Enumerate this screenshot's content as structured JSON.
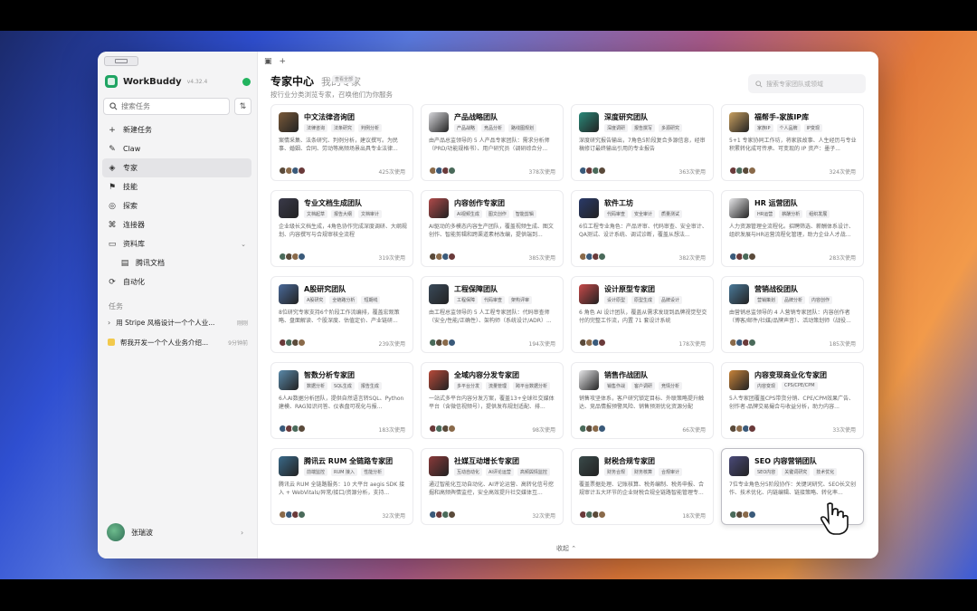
{
  "app": {
    "name": "WorkBuddy",
    "version": "v4.32.4"
  },
  "sidebar": {
    "search_placeholder": "搜索任务",
    "nav": [
      {
        "label": "新建任务",
        "icon": "plus-icon"
      },
      {
        "label": "Claw",
        "icon": "claw-icon"
      },
      {
        "label": "专家",
        "icon": "expert-icon",
        "active": true
      },
      {
        "label": "技能",
        "icon": "skill-icon"
      },
      {
        "label": "探索",
        "icon": "explore-icon"
      },
      {
        "label": "连接器",
        "icon": "connector-icon"
      },
      {
        "label": "资料库",
        "icon": "library-icon",
        "expandable": true
      },
      {
        "label": "腾讯文档",
        "icon": "doc-icon",
        "sub": true
      },
      {
        "label": "自动化",
        "icon": "automation-icon"
      }
    ],
    "tasks_label": "任务",
    "tasks": [
      {
        "title": "用 Stripe 风格设计一个个人业...",
        "time": "刚刚"
      },
      {
        "title": "帮我开发一个个人业务介绍...",
        "time": "9分钟前"
      }
    ],
    "user": {
      "name": "张瑞波"
    }
  },
  "header": {
    "title": "专家中心",
    "tab2": "我的专家",
    "tab2_badge": "查看全部",
    "subtitle": "按行业分类浏览专家，召唤他们为你服务",
    "search_placeholder": "搜索专家团队或领域"
  },
  "cards": [
    {
      "name": "中文法律咨询团",
      "tags": [
        "法律咨询",
        "法条研究",
        "判例分析"
      ],
      "desc": "案情采集、法条研究、判例分析，建议撰写。为民事、婚姻、合同、劳动等高频场景出具专业法律...",
      "uses": "425次使用",
      "color": "#7a5a3a"
    },
    {
      "name": "产品战略团队",
      "tags": [
        "产品战略",
        "竞品分析",
        "路线图规划"
      ],
      "desc": "由产品总监领导的 5 人产品专家团队：需求分析师（PRD/功能规格书）、用户研究员（调研综合分...",
      "uses": "378次使用",
      "color": "#d8d8dc"
    },
    {
      "name": "深度研究团队",
      "tags": [
        "深度调研",
        "报告撰写",
        "多源研究"
      ],
      "desc": "深度研究报告输出，7角色5阶段复合多源信息，经审稿修订最终输出引用的专业报告",
      "uses": "363次使用",
      "color": "#2a8a7a"
    },
    {
      "name": "福帮手-家族IP库",
      "tags": [
        "家族IP",
        "个人品牌",
        "IP变现"
      ],
      "desc": "5+1 专家协同工作坊，将家族故事、人生经历与专业积累转化成可传承、可变现的 IP 资产：墨子...",
      "uses": "324次使用",
      "color": "#c9a060"
    },
    {
      "name": "专业文档生成团队",
      "tags": [
        "文档起草",
        "报告大纲",
        "文档审计"
      ],
      "desc": "企业级长文档生成，4角色协作完成深度调研、大纲规划、内容撰写与合规审核全流程",
      "uses": "319次使用",
      "color": "#3a3a4a"
    },
    {
      "name": "内容创作专家团",
      "tags": [
        "AI视频生成",
        "图文创作",
        "智能剪辑"
      ],
      "desc": "AI驱动的多模态内容生产团队，覆盖视频生成、图文创作、智能剪辑和跨渠道素材改编，提供端到...",
      "uses": "385次使用",
      "color": "#b04a4a"
    },
    {
      "name": "软件工坊",
      "tags": [
        "代码审查",
        "安全审计",
        "质量测试"
      ],
      "desc": "6位工程专业角色：产品评审、代码审查、安全审计、QA测试、设计系统、调试诊断，覆盖从想法...",
      "uses": "382次使用",
      "color": "#2a3a6a"
    },
    {
      "name": "HR 运营团队",
      "tags": [
        "HR运营",
        "薪酬分析",
        "组织发展"
      ],
      "desc": "人力资源管理全流程化。招聘筛选、薪酬体系设计、组织发展与HR运营流程化管理，助力企业人才战...",
      "uses": "283次使用",
      "color": "#e8e8ea"
    },
    {
      "name": "A股研究团队",
      "tags": [
        "A股研究",
        "全链路分析",
        "短期线"
      ],
      "desc": "8位研究专家支持6个阶段工作流编排，覆盖宏观策略、盘面解读、个股深度、估值定价、产业链研...",
      "uses": "239次使用",
      "color": "#4a6a9a"
    },
    {
      "name": "工程保障团队",
      "tags": [
        "工程保障",
        "代码审查",
        "架构评审"
      ],
      "desc": "由工程总监领导的 5 人工程专家团队：代码审查师（安全/性能/正确性）、架构师（系统设计/ADR）...",
      "uses": "194次使用",
      "color": "#3a4a5a"
    },
    {
      "name": "设计原型专家团",
      "tags": [
        "设计原型",
        "原型生成",
        "品牌设计"
      ],
      "desc": "6 角色 AI 设计团队，覆盖从需求发现到品牌视觉型交付的完整工作流，内置 71 套设计系统",
      "uses": "178次使用",
      "color": "#c84a4a"
    },
    {
      "name": "营销战役团队",
      "tags": [
        "营销策划",
        "品牌分析",
        "内容创作"
      ],
      "desc": "由营销总监领导的 4 人营销专家团队：内容创作者（博客/邮件/社媒/品牌声音）、活动策划师（战役...",
      "uses": "185次使用",
      "color": "#4a7a9a"
    },
    {
      "name": "智数分析专家团",
      "tags": [
        "数据分析",
        "SQL生成",
        "报告生成"
      ],
      "desc": "6人AI数据分析团队，提供自然语言转SQL、Python建模、RAG知识问答、仪表盘可视化与报...",
      "uses": "183次使用",
      "color": "#5a8aaa"
    },
    {
      "name": "全域内容分发专家团",
      "tags": [
        "多平台分发",
        "流量管理",
        "跨平台数据分析"
      ],
      "desc": "一站式多平台内容分发方案，覆盖13+全球社交媒体平台（含微信视频号），提供发布规划适配、排...",
      "uses": "98次使用",
      "color": "#b84a3a"
    },
    {
      "name": "销售作战团队",
      "tags": [
        "销售作战",
        "客户调研",
        "竞情分析"
      ],
      "desc": "销售攻坚体系，客户研究锁定目标、外联策略提升触达、竞品情报预警风险、销售预测优化资源分配",
      "uses": "66次使用",
      "color": "#e8e8ea"
    },
    {
      "name": "内容变现商业化专家团",
      "tags": [
        "内容变现",
        "CPS/CPE/CPM"
      ],
      "desc": "5人专家团覆盖CPS带货分销、CPE/CPM效果广告、创作者-品牌交易撮合与收益分析，助力内容...",
      "uses": "33次使用",
      "color": "#c8843a"
    },
    {
      "name": "腾讯云 RUM 全链路专家团",
      "tags": [
        "前端监控",
        "RUM 接入",
        "性能分析"
      ],
      "desc": "腾讯云 RUM 全链路服务：10 大平台 aegis SDK 接入 + WebVitals/异常/接口/资源分析，支持...",
      "uses": "32次使用",
      "color": "#3a6a8a"
    },
    {
      "name": "社媒互动增长专家团",
      "tags": [
        "互动自动化",
        "AI评论运营",
        "高频舆情监控"
      ],
      "desc": "通过智能化互动自动化、AI评论运营、高转化信号挖掘和高频舆情监控，安全高效提升社交媒体互...",
      "uses": "32次使用",
      "color": "#8a3a3a"
    },
    {
      "name": "财税合规专家团",
      "tags": [
        "财务合规",
        "财务核算",
        "合规审计"
      ],
      "desc": "覆盖票据处理、记账核算、税务编制、税务申报、合规审计五大环节的企业财税合规全链路智能管理专...",
      "uses": "18次使用",
      "color": "#3a4a4a"
    },
    {
      "name": "SEO 内容营销团队",
      "tags": [
        "SEO内容",
        "关键词研究",
        "技术优化"
      ],
      "desc": "7位专业角色分5阶段协作：关键词研究、SEO长文创作、技术优化、内链编辑、链接策略、转化率...",
      "uses": "",
      "color": "#4a4a7a",
      "highlight": true
    }
  ],
  "footer": {
    "collapse_label": "收起"
  },
  "colors": {
    "accent_green": "#22b35e",
    "active_nav": "#e4e4e7"
  }
}
